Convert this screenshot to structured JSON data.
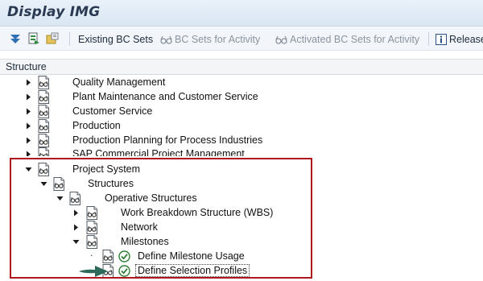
{
  "window": {
    "title": "Display IMG"
  },
  "toolbar": {
    "existing_bc_sets": "Existing BC Sets",
    "bc_sets_for_activity": "BC Sets for Activity",
    "activated_bc_sets_for_activity": "Activated BC Sets for Activity",
    "release": "Release"
  },
  "structure": {
    "header": "Structure"
  },
  "tree": {
    "quality_management": "Quality Management",
    "plant_maintenance": "Plant Maintenance and Customer Service",
    "customer_service": "Customer Service",
    "production": "Production",
    "production_planning": "Production Planning for Process Industries",
    "sap_commercial": "SAP Commercial Project Management",
    "project_system": "Project System",
    "structures": "Structures",
    "operative_structures": "Operative Structures",
    "wbs": "Work Breakdown Structure (WBS)",
    "network": "Network",
    "milestones": "Milestones",
    "define_milestone_usage": "Define Milestone Usage",
    "define_selection_profiles": "Define Selection Profiles"
  },
  "colors": {
    "highlight": "#b0171f",
    "arrow": "#2e6a5a",
    "title": "#2a3a52"
  }
}
